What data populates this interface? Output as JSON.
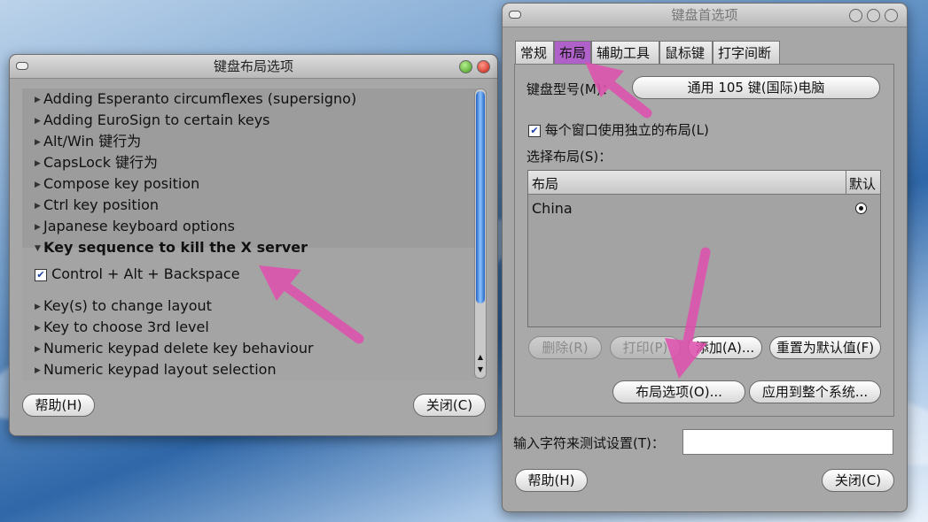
{
  "left_window": {
    "title": "键盘布局选项",
    "items": [
      {
        "label": "Adding Esperanto circumflexes (supersigno)"
      },
      {
        "label": "Adding EuroSign to certain keys"
      },
      {
        "label": "Alt/Win 键行为"
      },
      {
        "label": "CapsLock 键行为"
      },
      {
        "label": "Compose key position"
      },
      {
        "label": "Ctrl key position"
      },
      {
        "label": "Japanese keyboard options"
      },
      {
        "label": "Key sequence to kill the X server"
      },
      {
        "label": "Key(s) to change layout"
      },
      {
        "label": "Key to choose 3rd level"
      },
      {
        "label": "Numeric keypad delete key behaviour"
      },
      {
        "label": "Numeric keypad layout selection"
      }
    ],
    "sub_option": {
      "label": "Control + Alt + Backspace",
      "checked": true
    },
    "help_button": "帮助(H)",
    "close_button": "关闭(C)"
  },
  "right_window": {
    "title": "键盘首选项",
    "tabs": [
      "常规",
      "布局",
      "辅助工具",
      "鼠标键",
      "打字间断"
    ],
    "active_tab": "布局",
    "model_label": "键盘型号(M)：",
    "model_value": "通用 105 键(国际)电脑",
    "per_window_label": "每个窗口使用独立的布局(L)",
    "per_window_checked": true,
    "select_layout_label": "选择布局(S)：",
    "table": {
      "headers": [
        "布局",
        "默认"
      ],
      "rows": [
        {
          "layout": "China",
          "default": true
        }
      ]
    },
    "buttons": {
      "remove": "删除(R)",
      "print": "打印(P)",
      "add": "添加(A)...",
      "reset": "重置为默认值(F)",
      "layout_options": "布局选项(O)...",
      "apply_system": "应用到整个系统..."
    },
    "test_label": "输入字符来测试设置(T)：",
    "test_value": "",
    "help_button": "帮助(H)",
    "close_button": "关闭(C)"
  },
  "colors": {
    "window_bg": "#a7a7a7",
    "annotation_arrow": "#e14fae",
    "scrollbar": "#3b86e0"
  }
}
